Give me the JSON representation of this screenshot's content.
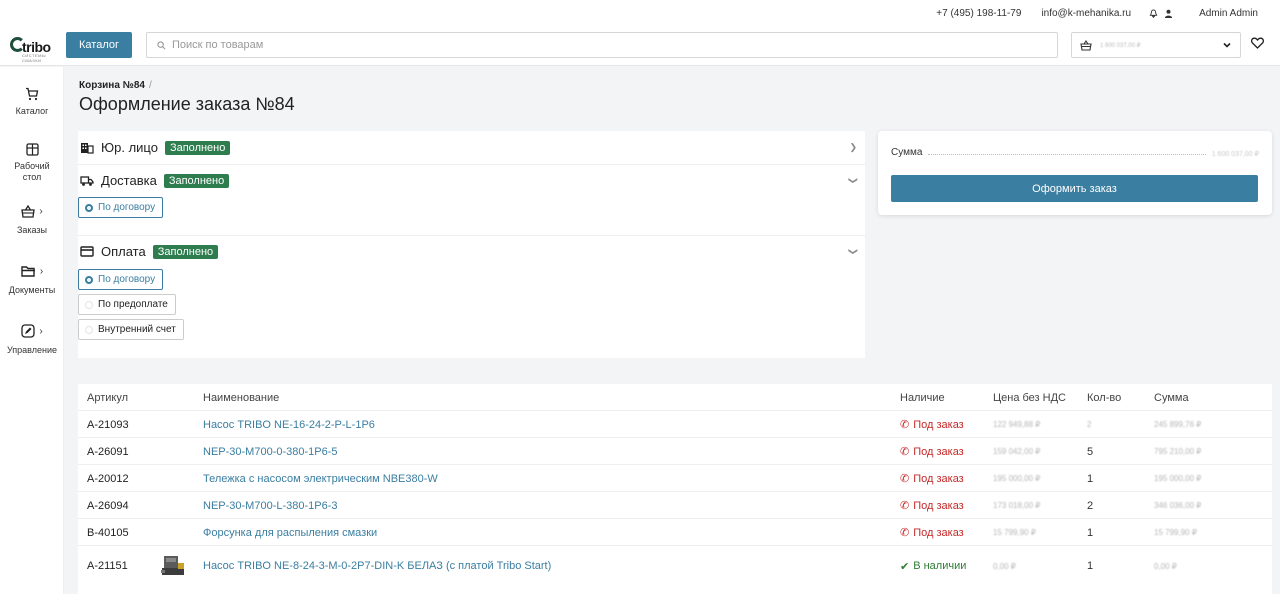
{
  "topbar": {
    "phone": "+7 (495) 198-11-79",
    "email": "info@k-mehanika.ru",
    "user_name": "Admin Admin"
  },
  "header": {
    "logo_text": "tribo",
    "logo_sub": "СИСТЕМЫ СМАЗКИ",
    "catalog_label": "Каталог",
    "search_placeholder": "Поиск по товарам",
    "cart_value": "1 600 037,00 ₽"
  },
  "sidebar": {
    "items": [
      {
        "label": "Каталог"
      },
      {
        "label": "Рабочий стол"
      },
      {
        "label": "Заказы"
      },
      {
        "label": "Документы"
      },
      {
        "label": "Управление"
      }
    ]
  },
  "breadcrumb": {
    "cart": "Корзина №84",
    "sep": "/"
  },
  "page_title": "Оформление заказа №84",
  "sections": {
    "legal": {
      "title": "Юр. лицо",
      "badge": "Заполнено"
    },
    "delivery": {
      "title": "Доставка",
      "badge": "Заполнено",
      "options": [
        "По договору"
      ]
    },
    "payment": {
      "title": "Оплата",
      "badge": "Заполнено",
      "options": [
        "По договору",
        "По предоплате",
        "Внутренний счет"
      ]
    }
  },
  "summary": {
    "label": "Сумма",
    "value": "1 600 037,00 ₽",
    "order_button": "Оформить заказ"
  },
  "table": {
    "headers": {
      "article": "Артикул",
      "name": "Наименование",
      "avail": "Наличие",
      "price": "Цена без НДС",
      "qty": "Кол-во",
      "sum": "Сумма"
    },
    "rows": [
      {
        "article": "A-21093",
        "name": "Насос TRIBO NE-16-24-2-P-L-1P6",
        "avail": "Под заказ",
        "price": "122 949,88 ₽",
        "qty": "2",
        "sum": "245 899,76 ₽"
      },
      {
        "article": "A-26091",
        "name": "NEP-30-M700-0-380-1P6-5",
        "avail": "Под заказ",
        "price": "159 042,00 ₽",
        "qty": "5",
        "sum": "795 210,00 ₽"
      },
      {
        "article": "A-20012",
        "name": "Тележка с насосом электрическим NBE380-W",
        "avail": "Под заказ",
        "price": "195 000,00 ₽",
        "qty": "1",
        "sum": "195 000,00 ₽"
      },
      {
        "article": "A-26094",
        "name": "NEP-30-M700-L-380-1P6-3",
        "avail": "Под заказ",
        "price": "173 018,00 ₽",
        "qty": "2",
        "sum": "346 036,00 ₽"
      },
      {
        "article": "B-40105",
        "name": "Форсунка для распыления смазки",
        "avail": "Под заказ",
        "price": "15 799,90 ₽",
        "qty": "1",
        "sum": "15 799,90 ₽"
      },
      {
        "article": "A-21151",
        "name": "Насос TRIBO NE-8-24-3-M-0-2P7-DIN-K БЕЛАЗ (с платой Tribo Start)",
        "avail": "В наличии",
        "price": "0,00 ₽",
        "qty": "1",
        "sum": "0,00 ₽"
      }
    ]
  },
  "colors": {
    "accent": "#3a7ea1",
    "success": "#2e7d4f",
    "danger": "#c62828"
  }
}
